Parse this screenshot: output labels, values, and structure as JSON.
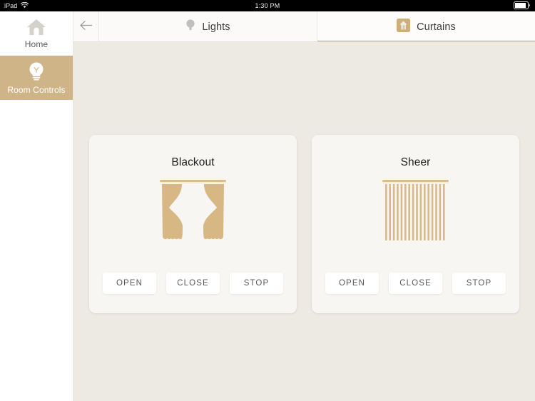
{
  "status_bar": {
    "device": "iPad",
    "wifi_icon": "wifi-icon",
    "time": "1:30 PM",
    "battery_icon": "battery-icon"
  },
  "sidebar": {
    "items": [
      {
        "label": "Home",
        "icon": "home-icon",
        "active": false
      },
      {
        "label": "Room Controls",
        "icon": "lightbulb-icon",
        "active": true
      }
    ]
  },
  "tabbar": {
    "back_icon": "back-arrow-icon",
    "tabs": [
      {
        "label": "Lights",
        "icon": "lightbulb-icon",
        "active": false
      },
      {
        "label": "Curtains",
        "icon": "curtain-icon",
        "active": true
      }
    ]
  },
  "main": {
    "cards": [
      {
        "title": "Blackout",
        "art": "blackout-curtain-illustration",
        "buttons": [
          {
            "label": "OPEN"
          },
          {
            "label": "CLOSE"
          },
          {
            "label": "STOP"
          }
        ]
      },
      {
        "title": "Sheer",
        "art": "sheer-curtain-illustration",
        "buttons": [
          {
            "label": "OPEN"
          },
          {
            "label": "CLOSE"
          },
          {
            "label": "STOP"
          }
        ]
      }
    ]
  },
  "colors": {
    "accent_gold": "#cfb488",
    "accent_underline": "#c2a173",
    "page_background": "#edeae3",
    "card_background": "#f8f6f2",
    "curtain_fill": "#d7b783",
    "status_bar": "#000000"
  }
}
